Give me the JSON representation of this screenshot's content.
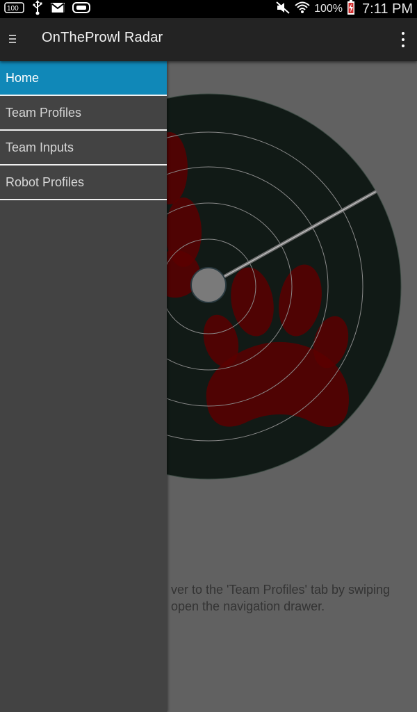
{
  "status_bar": {
    "battery_percent": "100%",
    "time": "7:11 PM",
    "left_icons": [
      "notification-100-icon",
      "usb-icon",
      "gmail-icon",
      "gamepad-icon"
    ],
    "right_icons": [
      "mute-icon",
      "wifi-icon",
      "battery-charging-icon"
    ]
  },
  "action_bar": {
    "title": "OnTheProwl Radar"
  },
  "drawer": {
    "items": [
      {
        "label": "Home",
        "selected": true
      },
      {
        "label": "Team Profiles",
        "selected": false
      },
      {
        "label": "Team Inputs",
        "selected": false
      },
      {
        "label": "Robot Profiles",
        "selected": false
      }
    ]
  },
  "content": {
    "hint_line1": "ver to the 'Team Profiles' tab by swiping",
    "hint_line2": "open the navigation drawer."
  },
  "colors": {
    "accent": "#1088b8",
    "drawer_bg": "#434343",
    "radar_bg": "#111a16",
    "paw": "#5a0000"
  }
}
